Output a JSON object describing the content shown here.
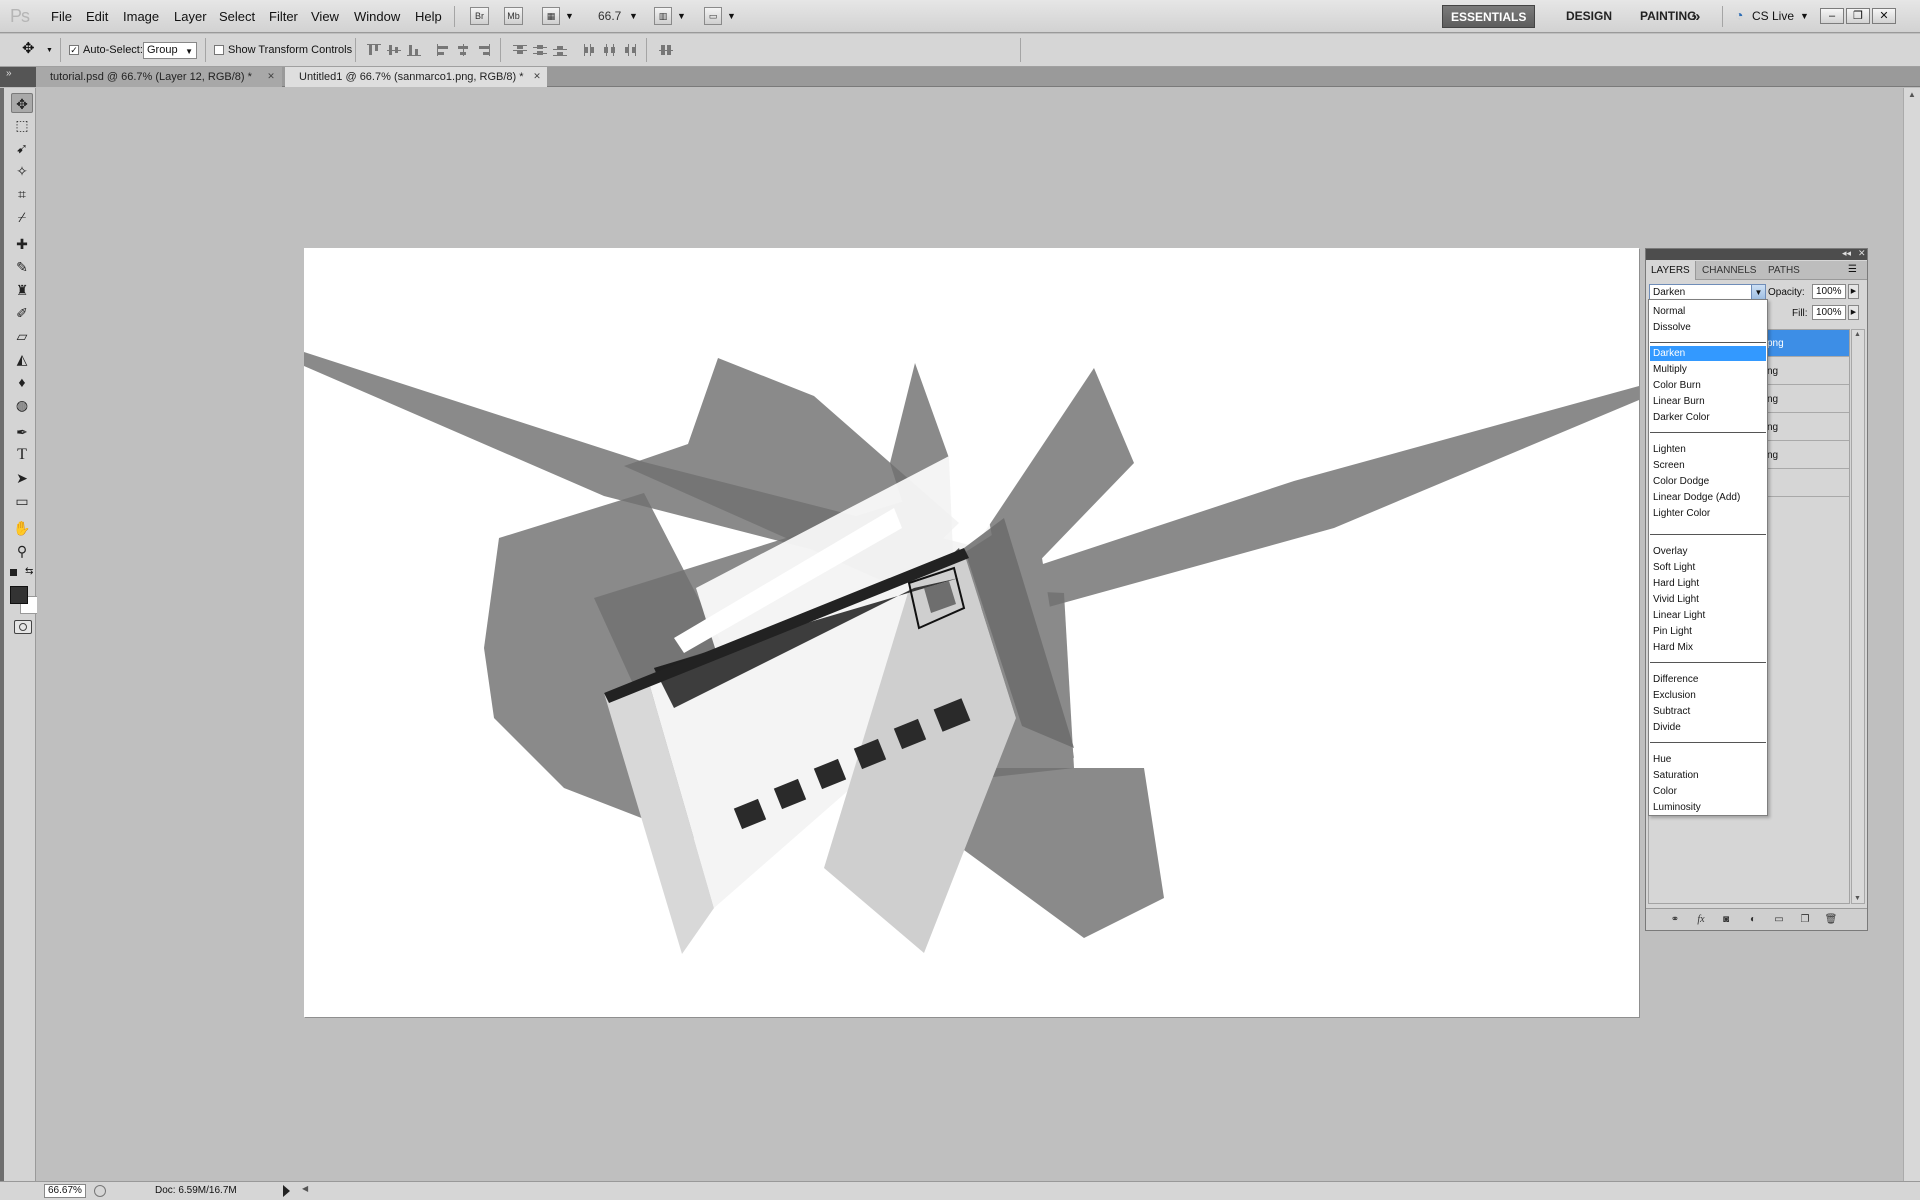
{
  "app": {
    "logo": "Ps",
    "menu": [
      "File",
      "Edit",
      "Image",
      "Layer",
      "Select",
      "Filter",
      "View",
      "Window",
      "Help"
    ],
    "bridge_btn": "Br",
    "minibridge_btn": "Mb",
    "zoom_value": "66.7",
    "workspaces": [
      "ESSENTIALS",
      "DESIGN",
      "PAINTING"
    ],
    "more": "»",
    "cs_live": "CS Live"
  },
  "options_bar": {
    "auto_select_label": "Auto-Select:",
    "auto_select_checked": true,
    "auto_select_value": "Group",
    "show_transform_label": "Show Transform Controls",
    "show_transform_checked": false
  },
  "tabs": [
    {
      "label": "tutorial.psd @ 66.7% (Layer 12, RGB/8) *",
      "active": false
    },
    {
      "label": "Untitled1 @ 66.7% (sanmarco1.png, RGB/8) *",
      "active": true
    }
  ],
  "status": {
    "zoom": "66.67%",
    "doc_info": "Doc: 6.59M/16.7M"
  },
  "layers_panel": {
    "tabs": [
      "LAYERS",
      "CHANNELS",
      "PATHS"
    ],
    "blend_mode": "Darken",
    "opacity_label": "Opacity:",
    "opacity_value": "100%",
    "fill_label": "Fill:",
    "fill_value": "100%",
    "layers": [
      {
        "name_fragment": "png",
        "selected": true
      },
      {
        "name_fragment": "ng",
        "selected": false
      },
      {
        "name_fragment": "ng",
        "selected": false
      },
      {
        "name_fragment": "ng",
        "selected": false
      },
      {
        "name_fragment": "ng",
        "selected": false
      },
      {
        "name_fragment": "",
        "selected": false
      }
    ]
  },
  "blend_dropdown": {
    "groups": [
      [
        "Normal",
        "Dissolve"
      ],
      [
        "Darken",
        "Multiply",
        "Color Burn",
        "Linear Burn",
        "Darker Color"
      ],
      [
        "Lighten",
        "Screen",
        "Color Dodge",
        "Linear Dodge (Add)",
        "Lighter Color"
      ],
      [
        "Overlay",
        "Soft Light",
        "Hard Light",
        "Vivid Light",
        "Linear Light",
        "Pin Light",
        "Hard Mix"
      ],
      [
        "Difference",
        "Exclusion",
        "Subtract",
        "Divide"
      ],
      [
        "Hue",
        "Saturation",
        "Color",
        "Luminosity"
      ]
    ],
    "selected": "Darken"
  },
  "colors": {
    "accent_selected": "#3399ff",
    "layer_selected": "#3d8ee6",
    "workspace_active": "#5d5d5d",
    "foreground": "#333333",
    "background": "#ffffff"
  }
}
